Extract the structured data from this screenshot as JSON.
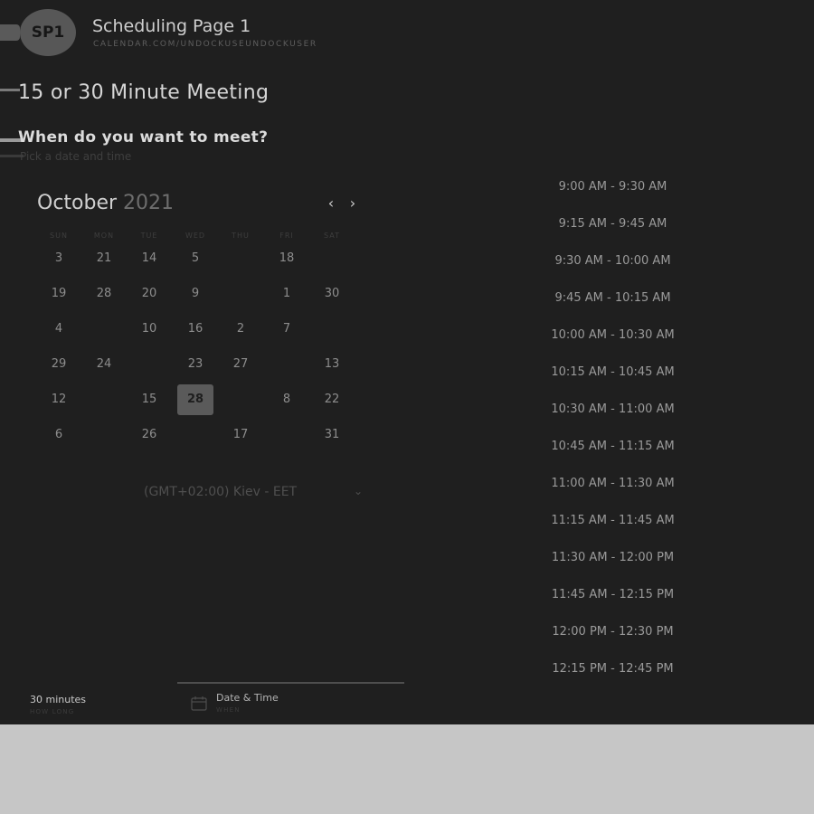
{
  "header": {
    "avatar_initials": "SP1",
    "title": "Scheduling Page 1",
    "url": "CALENDAR.COM/UNDOCKUSEUNDOCKUSER"
  },
  "meeting": {
    "title": "15 or 30 Minute Meeting",
    "question": "When do you want to meet?",
    "subtitle": "Pick a date and time"
  },
  "calendar": {
    "month": "October",
    "year": "2021",
    "weekdays": [
      "SUN",
      "MON",
      "TUE",
      "WED",
      "THU",
      "FRI",
      "SAT"
    ],
    "rows": [
      [
        "3",
        "21",
        "14",
        "5",
        "",
        "18",
        ""
      ],
      [
        "19",
        "28",
        "20",
        "9",
        "",
        "1",
        "30"
      ],
      [
        "4",
        "",
        "10",
        "16",
        "2",
        "7",
        ""
      ],
      [
        "29",
        "24",
        "",
        "23",
        "27",
        "",
        "13"
      ],
      [
        "12",
        "",
        "15",
        "28",
        "",
        "8",
        "22"
      ],
      [
        "6",
        "",
        "26",
        "",
        "17",
        "",
        "31"
      ]
    ],
    "selected_day": "28",
    "timezone": "(GMT+02:00) Kiev - EET"
  },
  "time_slots": [
    "9:00 AM - 9:30 AM",
    "9:15 AM - 9:45 AM",
    "9:30 AM - 10:00 AM",
    "9:45 AM - 10:15 AM",
    "10:00 AM - 10:30 AM",
    "10:15 AM - 10:45 AM",
    "10:30 AM - 11:00 AM",
    "10:45 AM - 11:15 AM",
    "11:00 AM - 11:30 AM",
    "11:15 AM - 11:45 AM",
    "11:30 AM - 12:00 PM",
    "11:45 AM - 12:15 PM",
    "12:00 PM - 12:30 PM",
    "12:15 PM - 12:45 PM"
  ],
  "steps": {
    "duration_value": "30 minutes",
    "duration_label": "HOW LONG",
    "datetime_value": "Date & Time",
    "datetime_label": "WHEN"
  },
  "icons": {
    "prev": "chevron-left-icon",
    "next": "chevron-right-icon",
    "timezone": "chevron-down-icon",
    "step": "calendar-icon"
  }
}
